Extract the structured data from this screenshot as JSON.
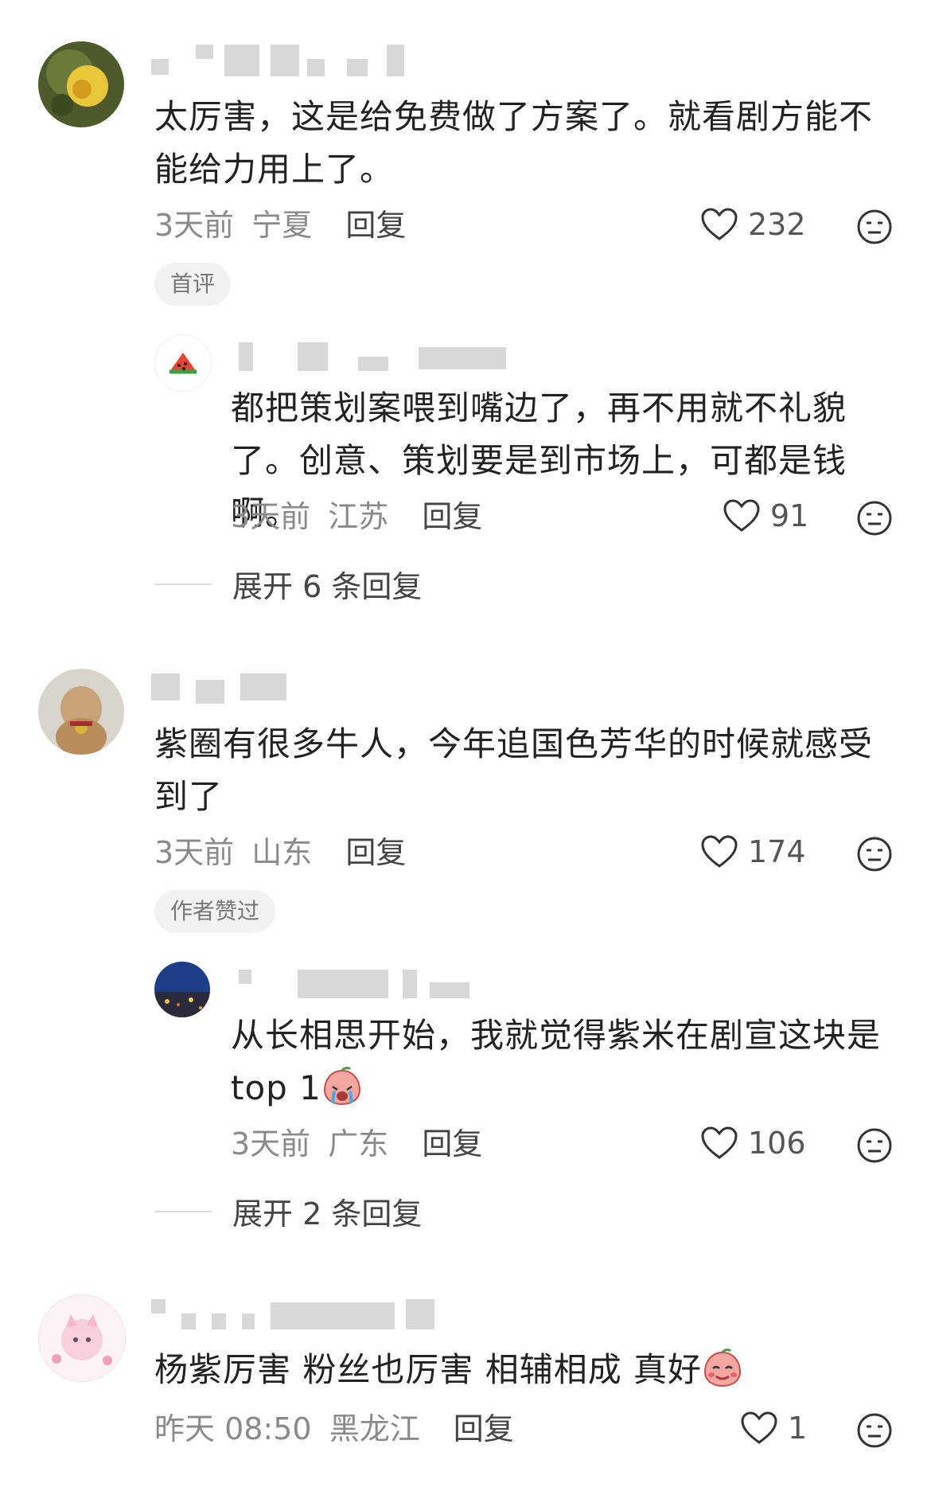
{
  "comments": [
    {
      "text": "太厉害，这是给免费做了方案了。就看剧方能不能给力用上了。",
      "time": "3天前",
      "location": "宁夏",
      "reply_label": "回复",
      "likes": "232",
      "tag": "首评",
      "reply": {
        "text": "都把策划案喂到嘴边了，再不用就不礼貌了。创意、策划要是到市场上，可都是钱啊。",
        "time": "3天前",
        "location": "江苏",
        "reply_label": "回复",
        "likes": "91"
      },
      "expand_label": "展开 6 条回复"
    },
    {
      "text": "紫圈有很多牛人，今年追国色芳华的时候就感受到了",
      "time": "3天前",
      "location": "山东",
      "reply_label": "回复",
      "likes": "174",
      "tag": "作者赞过",
      "reply": {
        "text": "从长相思开始，我就觉得紫米在剧宣这块是top 1",
        "time": "3天前",
        "location": "广东",
        "reply_label": "回复",
        "likes": "106"
      },
      "expand_label": "展开 2 条回复"
    },
    {
      "text": "杨紫厉害 粉丝也厉害 相辅相成 真好",
      "time": "昨天 08:50",
      "location": "黑龙江",
      "reply_label": "回复",
      "likes": "1"
    }
  ],
  "icons": {
    "like": "heart-outline-icon",
    "dislike": "neutral-face-icon",
    "emoji": "crying-peach-emoji"
  },
  "colors": {
    "meta": "#8a8a8a",
    "tag_bg": "#f2f2f2",
    "text": "#222222"
  }
}
